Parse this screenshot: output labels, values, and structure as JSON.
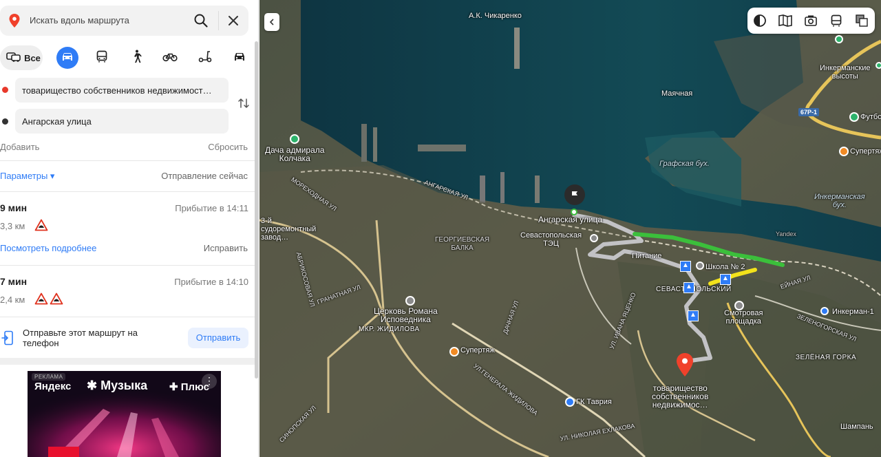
{
  "search": {
    "placeholder": "Искать вдоль маршрута"
  },
  "modes": {
    "all_label": "Все"
  },
  "waypoints": {
    "from": "товарищество собственников недвижимост…",
    "to": "Ангарская улица"
  },
  "actions": {
    "add": "Добавить",
    "reset": "Сбросить"
  },
  "params": {
    "label": "Параметры ▾",
    "departure": "Отправление сейчас"
  },
  "routes": [
    {
      "time": "9 мин",
      "arrival": "Прибытие в 14:11",
      "distance": "3,3 км"
    },
    {
      "time": "7 мин",
      "arrival": "Прибытие в 14:10",
      "distance": "2,4 км"
    }
  ],
  "route_links": {
    "details": "Посмотреть подробнее",
    "fix": "Исправить"
  },
  "send": {
    "text": "Отправьте этот маршрут на телефон",
    "button": "Отправить"
  },
  "ad": {
    "tag": "РЕКЛАМА",
    "brand": "Яндекс",
    "product": "✱ Музыка",
    "plus": "✚ Плюс",
    "menu": "⋮"
  },
  "map": {
    "labels": {
      "chikarenko": "А.К. Чикаренко",
      "inkerman_heights": "Инкерманские\nвысоты",
      "mayachnaya": "Маячная",
      "graf_bay": "Графская бух.",
      "inkerman_bay": "Инкерманская\nбух.",
      "kolchak": "Дача адмирала\nКолчака",
      "angarskaya": "Ангарская улица",
      "shipyard": "3-й\nсудоремонтный\nзавод…",
      "tec": "Севастопольская\nТЭЦ",
      "pitanie": "Питание",
      "school": "Школа № 2",
      "sevastopol": "СЕВАСТОПОЛЬСКИЙ",
      "view_area": "Смотровая\nплощадка",
      "inkerman1": "Инкерман-1",
      "green_hill": "ЗЕЛЁНАЯ ГОРКА",
      "church": "Церковь Романа\nИсповедника",
      "zhidilova": "МКР. ЖИДИЛОВА",
      "supertyazh": "Супертяж",
      "supertyazh2": "Супертяж",
      "tavria": "ГК Таврия",
      "destination": "товарищество\nсобственников\nнедвижимос…",
      "shampan": "Шампань",
      "futbol": "Футбо",
      "yandex": "Yandex",
      "georgievskaya": "ГЕОРГИЕВСКАЯ\nБАЛКА",
      "road_67": "67Р-1",
      "street_angarskaya": "АНГАРСКАЯ УЛ",
      "street_zhidilova": "УЛ.ГЕНЕРАЛА ЖИДИЛОВА",
      "street_granatnaya": "ГРАНАТНАЯ УЛ",
      "street_zelenogorskaya": "ЗЕЛЕНОГОРСКАЯ УЛ",
      "street_yacenko": "УЛ. ИВАНА ЯЦЕНКО",
      "street_sinopskaya": "СИНОПСКАЯ УЛ",
      "street_khlakova": "УЛ. НИКОЛАЯ ЕХЛАКОВА",
      "street_abrikosovaya": "АБРИКОСОВАЯ УЛ",
      "street_dachnaya": "ДАЧНАЯ УЛ",
      "street_morekhodnaya": "МОРЕХОДНАЯ УЛ",
      "street_inkerman": "ЕЙНАЯ УЛ"
    }
  },
  "colors": {
    "accent": "#2f7cf6",
    "route_green": "#3bbf3b",
    "route_yellow": "#f2e21b",
    "origin_dot": "#e8392b",
    "water": "#0f3d4a"
  }
}
